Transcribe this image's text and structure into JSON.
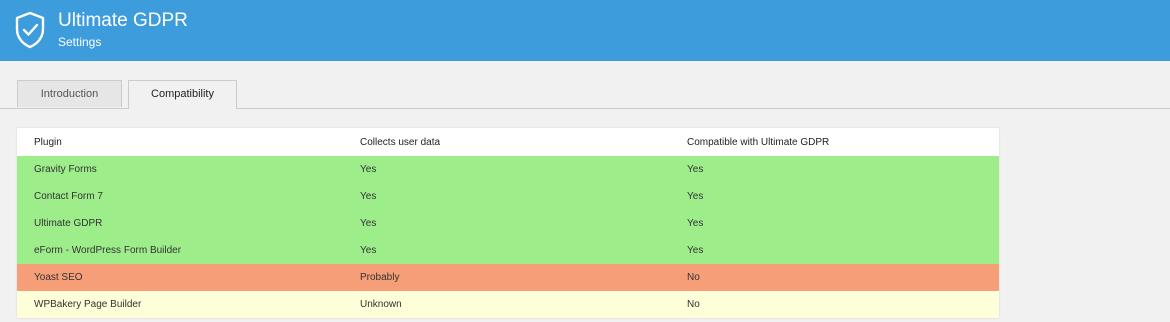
{
  "header": {
    "title": "Ultimate GDPR",
    "subtitle": "Settings",
    "icon": "shield-check-icon",
    "background": "#3d9ddc"
  },
  "tabs": [
    {
      "label": "Introduction",
      "active": false
    },
    {
      "label": "Compatibility",
      "active": true
    }
  ],
  "table": {
    "columns": [
      "Plugin",
      "Collects user data",
      "Compatible with Ultimate GDPR"
    ],
    "rows": [
      {
        "plugin": "Gravity Forms",
        "collects": "Yes",
        "compatible": "Yes",
        "color": "#9ded8b"
      },
      {
        "plugin": "Contact Form 7",
        "collects": "Yes",
        "compatible": "Yes",
        "color": "#9ded8b"
      },
      {
        "plugin": "Ultimate GDPR",
        "collects": "Yes",
        "compatible": "Yes",
        "color": "#9ded8b"
      },
      {
        "plugin": "eForm - WordPress Form Builder",
        "collects": "Yes",
        "compatible": "Yes",
        "color": "#9ded8b"
      },
      {
        "plugin": "Yoast SEO",
        "collects": "Probably",
        "compatible": "No",
        "color": "#f59e78"
      },
      {
        "plugin": "WPBakery Page Builder",
        "collects": "Unknown",
        "compatible": "No",
        "color": "#fefed9"
      }
    ]
  }
}
